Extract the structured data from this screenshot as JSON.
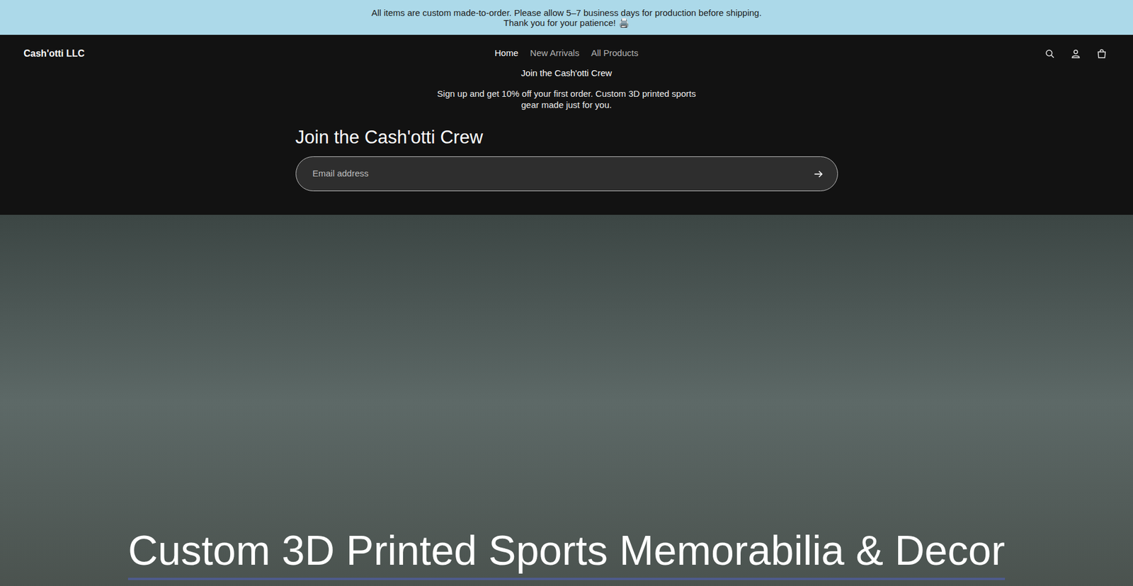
{
  "announcement": {
    "lines": [
      "All items are custom made-to-order. Please allow 5–7 business days for production before shipping.",
      "Thank you for your patience! 🖨️"
    ]
  },
  "header": {
    "logo": "Cash'otti LLC",
    "nav": [
      {
        "label": "Home",
        "selected": true
      },
      {
        "label": "New Arrivals",
        "selected": false
      },
      {
        "label": "All Products",
        "selected": false
      }
    ]
  },
  "signup": {
    "eyebrow": "Join the Cash'otti Crew",
    "description": "Sign up and get 10% off your first order. Custom 3D printed sports gear made just for you.",
    "heading": "Join the Cash'otti Crew",
    "email_placeholder": "Email address"
  },
  "hero": {
    "heading": "Custom 3D Printed Sports Memorabilia & Decor"
  }
}
